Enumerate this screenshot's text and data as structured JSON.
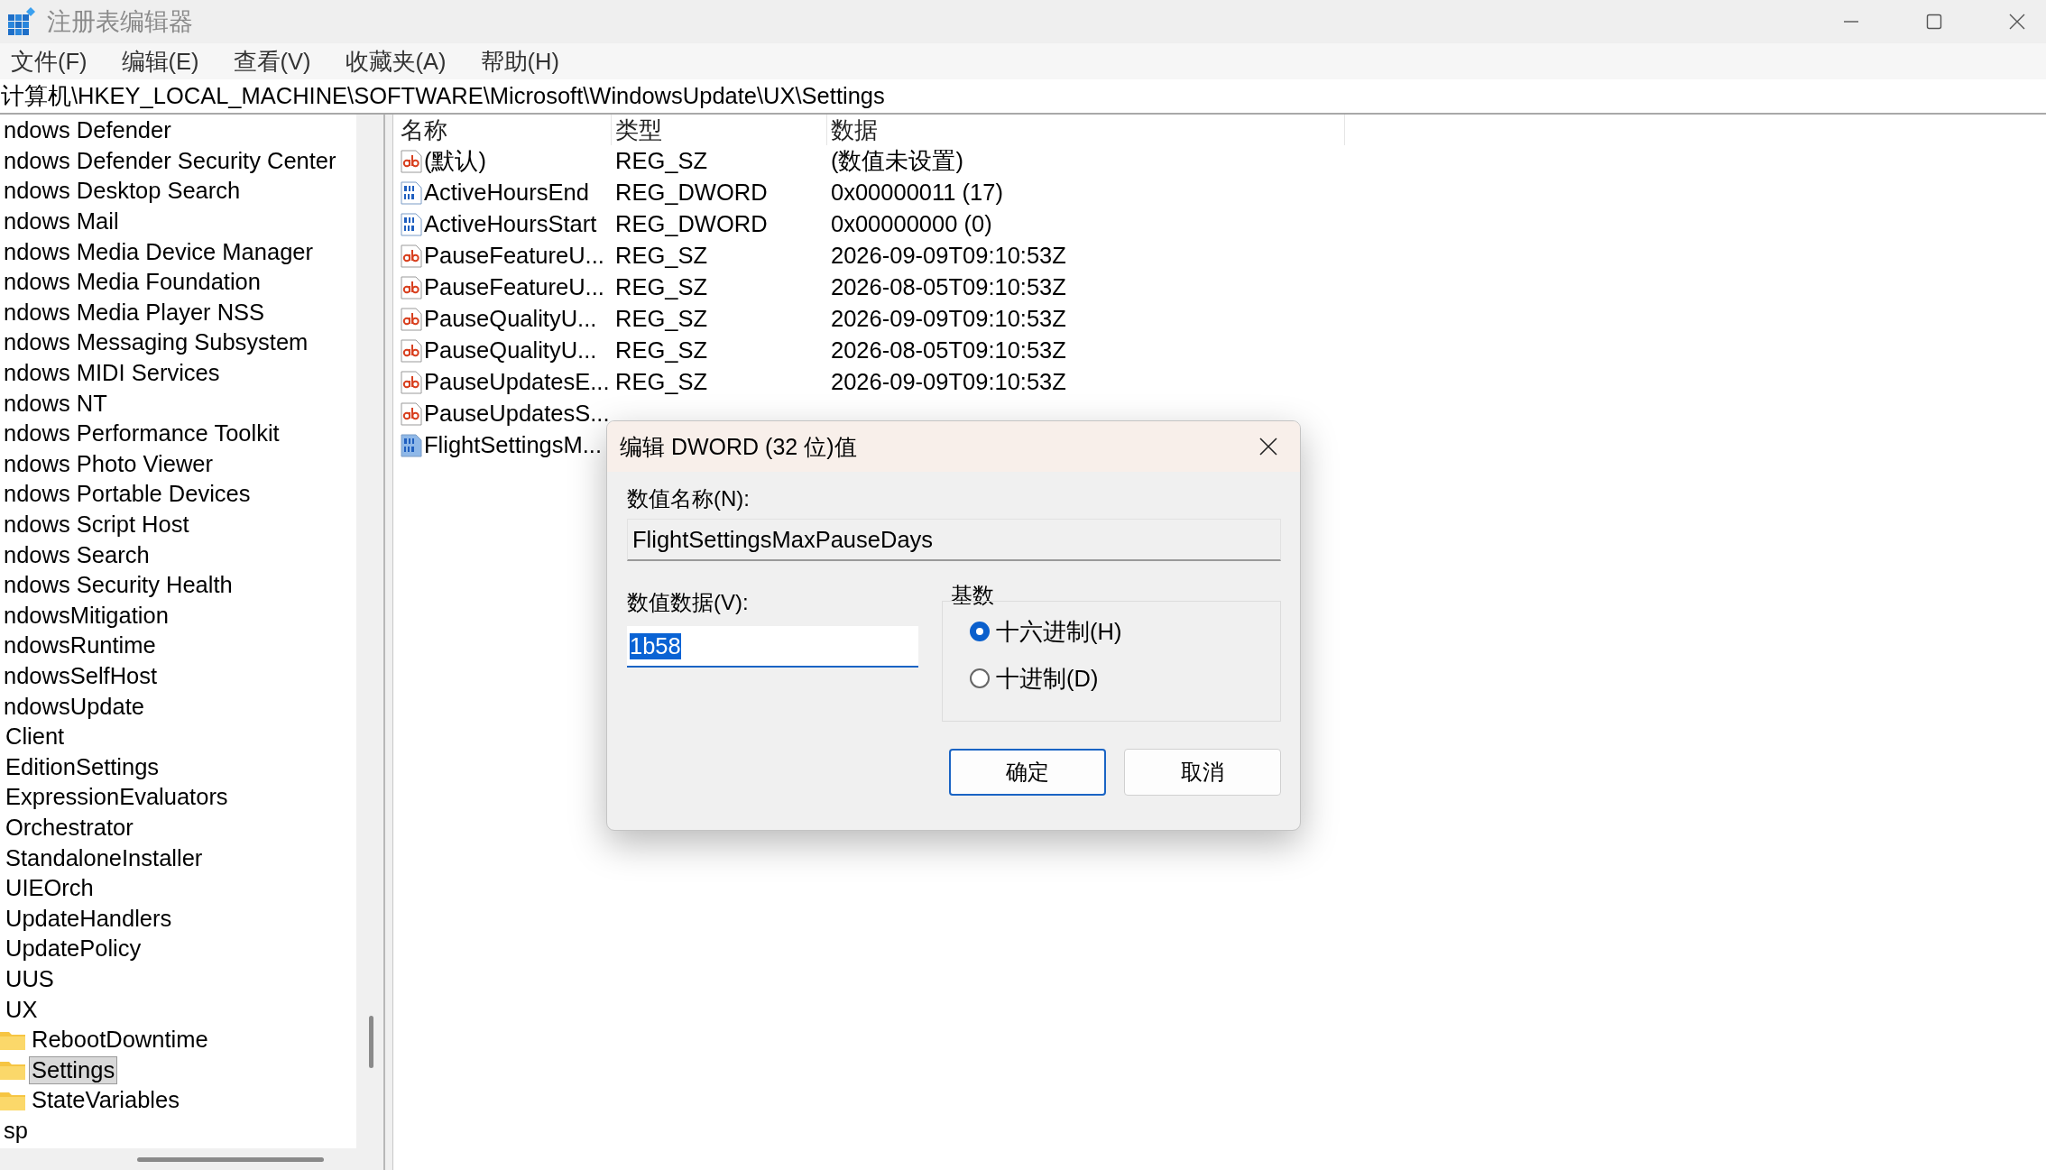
{
  "window": {
    "title": "注册表编辑器"
  },
  "menu": [
    "文件(F)",
    "编辑(E)",
    "查看(V)",
    "收藏夹(A)",
    "帮助(H)"
  ],
  "address": "计算机\\HKEY_LOCAL_MACHINE\\SOFTWARE\\Microsoft\\WindowsUpdate\\UX\\Settings",
  "tree": [
    {
      "label": "ndows Defender",
      "selected": false
    },
    {
      "label": "ndows Defender Security Center",
      "selected": false
    },
    {
      "label": "ndows Desktop Search",
      "selected": false
    },
    {
      "label": "ndows Mail",
      "selected": false
    },
    {
      "label": "ndows Media Device Manager",
      "selected": false
    },
    {
      "label": "ndows Media Foundation",
      "selected": false
    },
    {
      "label": "ndows Media Player NSS",
      "selected": false
    },
    {
      "label": "ndows Messaging Subsystem",
      "selected": false
    },
    {
      "label": "ndows MIDI Services",
      "selected": false
    },
    {
      "label": "ndows NT",
      "selected": false
    },
    {
      "label": "ndows Performance Toolkit",
      "selected": false
    },
    {
      "label": "ndows Photo Viewer",
      "selected": false
    },
    {
      "label": "ndows Portable Devices",
      "selected": false
    },
    {
      "label": "ndows Script Host",
      "selected": false
    },
    {
      "label": "ndows Search",
      "selected": false
    },
    {
      "label": "ndows Security Health",
      "selected": false
    },
    {
      "label": "ndowsMitigation",
      "selected": false
    },
    {
      "label": "ndowsRuntime",
      "selected": false
    },
    {
      "label": "ndowsSelfHost",
      "selected": false
    },
    {
      "label": "ndowsUpdate",
      "selected": false,
      "children": [
        {
          "label": "Client",
          "selected": false
        },
        {
          "label": "EditionSettings",
          "selected": false
        },
        {
          "label": "ExpressionEvaluators",
          "selected": false
        },
        {
          "label": "Orchestrator",
          "selected": false
        },
        {
          "label": "StandaloneInstaller",
          "selected": false
        },
        {
          "label": "UIEOrch",
          "selected": false
        },
        {
          "label": "UpdateHandlers",
          "selected": false
        },
        {
          "label": "UpdatePolicy",
          "selected": false
        },
        {
          "label": "UUS",
          "selected": false
        },
        {
          "label": "UX",
          "selected": false,
          "children": [
            {
              "label": "RebootDowntime",
              "selected": false
            },
            {
              "label": "Settings",
              "selected": true
            },
            {
              "label": "StateVariables",
              "selected": false
            }
          ]
        }
      ]
    },
    {
      "label": "sp",
      "selected": false
    }
  ],
  "list": {
    "columns": [
      "名称",
      "类型",
      "数据"
    ],
    "rows": [
      {
        "kind": "string",
        "name": "(默认)",
        "type": "REG_SZ",
        "data": "(数值未设置)",
        "selected": false
      },
      {
        "kind": "dword",
        "name": "ActiveHoursEnd",
        "type": "REG_DWORD",
        "data": "0x00000011 (17)",
        "selected": false
      },
      {
        "kind": "dword",
        "name": "ActiveHoursStart",
        "type": "REG_DWORD",
        "data": "0x00000000 (0)",
        "selected": false
      },
      {
        "kind": "string",
        "name": "PauseFeatureU...",
        "type": "REG_SZ",
        "data": "2026-09-09T09:10:53Z",
        "selected": false
      },
      {
        "kind": "string",
        "name": "PauseFeatureU...",
        "type": "REG_SZ",
        "data": "2026-08-05T09:10:53Z",
        "selected": false
      },
      {
        "kind": "string",
        "name": "PauseQualityU...",
        "type": "REG_SZ",
        "data": "2026-09-09T09:10:53Z",
        "selected": false
      },
      {
        "kind": "string",
        "name": "PauseQualityU...",
        "type": "REG_SZ",
        "data": "2026-08-05T09:10:53Z",
        "selected": false
      },
      {
        "kind": "string",
        "name": "PauseUpdatesE...",
        "type": "REG_SZ",
        "data": "2026-09-09T09:10:53Z",
        "selected": false
      },
      {
        "kind": "string",
        "name": "PauseUpdatesS...",
        "selected": false
      },
      {
        "kind": "dword",
        "name": "FlightSettingsM...",
        "selected": true
      }
    ]
  },
  "dialog": {
    "title": "编辑 DWORD (32 位)值",
    "name_label": "数值名称(N):",
    "name_value": "FlightSettingsMaxPauseDays",
    "data_label": "数值数据(V):",
    "data_value": "1b58",
    "base": {
      "legend": "基数",
      "options": [
        {
          "label": "十六进制(H)",
          "selected": true
        },
        {
          "label": "十进制(D)",
          "selected": false
        }
      ]
    },
    "buttons": [
      {
        "label": "确定",
        "default": true
      },
      {
        "label": "取消",
        "default": false
      }
    ]
  }
}
